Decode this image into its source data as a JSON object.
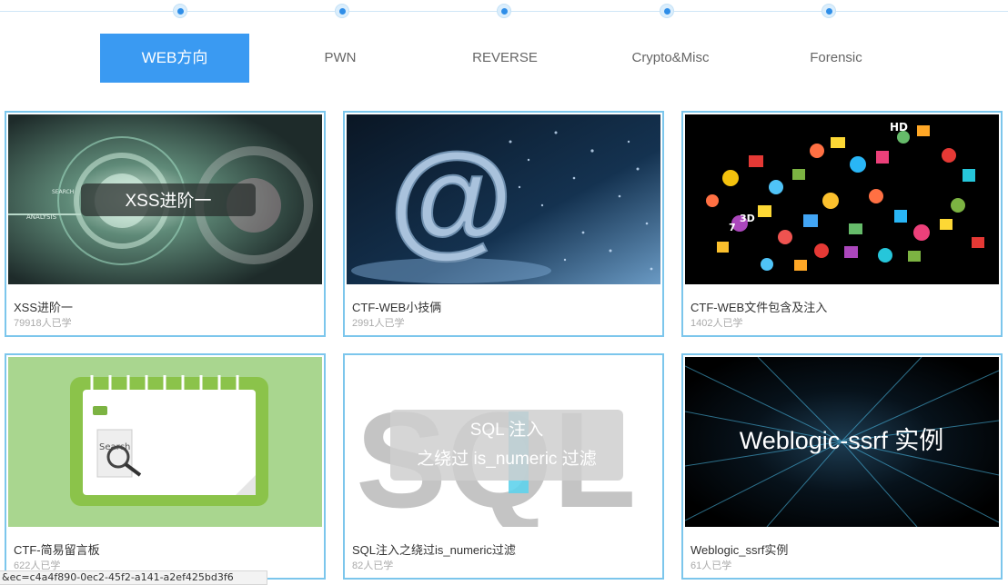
{
  "tabs": [
    {
      "label": "WEB方向",
      "active": true
    },
    {
      "label": "PWN",
      "active": false
    },
    {
      "label": "REVERSE",
      "active": false
    },
    {
      "label": "Crypto&Misc",
      "active": false
    },
    {
      "label": "Forensic",
      "active": false
    }
  ],
  "courses": [
    {
      "title": "XSS进阶一",
      "learners": "79918人已学",
      "thumb_text": "XSS进阶一",
      "thumb_small": [
        "ANALYSIS",
        "SEARCH"
      ]
    },
    {
      "title": "CTF-WEB小技俩",
      "learners": "2991人已学",
      "thumb_text": "@"
    },
    {
      "title": "CTF-WEB文件包含及注入",
      "learners": "1402人已学",
      "thumb_labels": [
        "HD",
        "3D",
        "7"
      ]
    },
    {
      "title": "CTF-简易留言板",
      "learners": "622人已学",
      "thumb_text": "Search"
    },
    {
      "title": "SQL注入之绕过is_numeric过滤",
      "learners": "82人已学",
      "thumb_lines": [
        "SQL 注入",
        "之绕过 is_numeric 过滤"
      ],
      "thumb_bg": "SQL"
    },
    {
      "title": "Weblogic_ssrf实例",
      "learners": "61人已学",
      "thumb_text": "Weblogic-ssrf 实例"
    }
  ],
  "status_url": "&ec=c4a4f890-0ec2-45f2-a141-a2ef425bd3f6",
  "colors": {
    "accent": "#3a9af2",
    "card_border": "#7cc6ec"
  }
}
